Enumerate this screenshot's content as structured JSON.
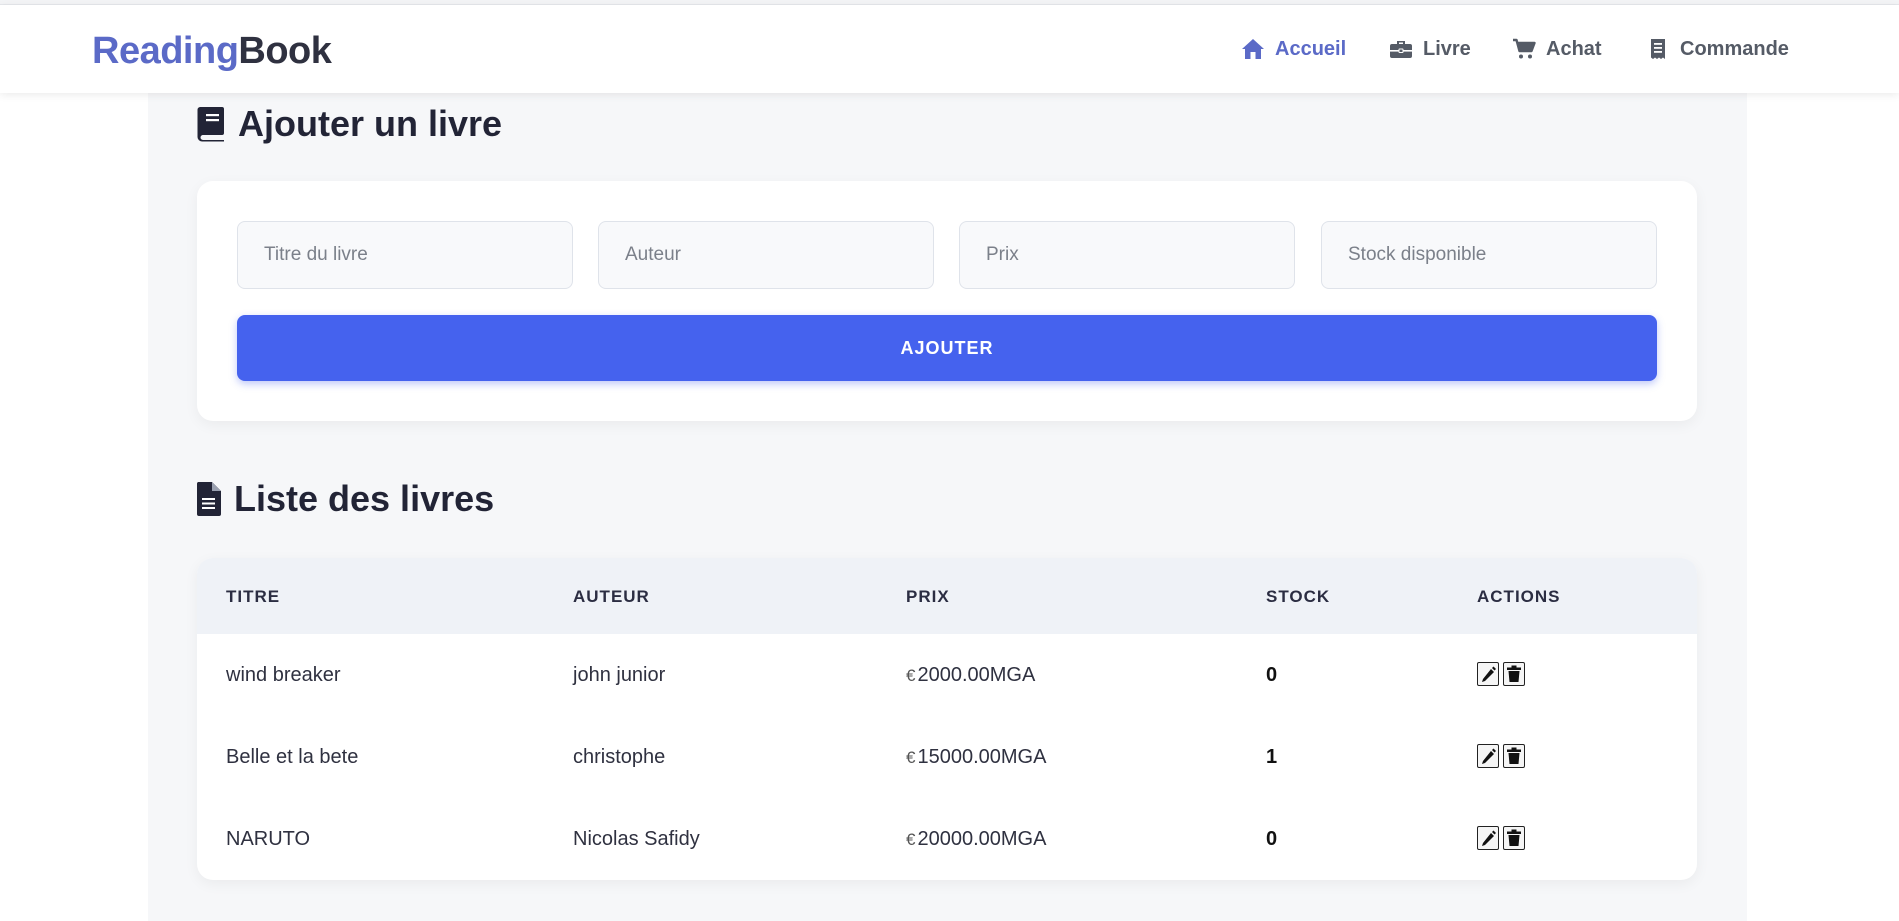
{
  "brand": {
    "part1": "Reading",
    "part2": "Book"
  },
  "nav": [
    {
      "label": "Accueil",
      "icon": "home-icon",
      "active": true
    },
    {
      "label": "Livre",
      "icon": "briefcase-icon",
      "active": false
    },
    {
      "label": "Achat",
      "icon": "cart-icon",
      "active": false
    },
    {
      "label": "Commande",
      "icon": "receipt-icon",
      "active": false
    }
  ],
  "add_section": {
    "title": "Ajouter un livre",
    "icon": "book-icon",
    "fields": [
      {
        "placeholder": "Titre du livre",
        "value": ""
      },
      {
        "placeholder": "Auteur",
        "value": ""
      },
      {
        "placeholder": "Prix",
        "value": ""
      },
      {
        "placeholder": "Stock disponible",
        "value": ""
      }
    ],
    "submit_label": "AJOUTER"
  },
  "list_section": {
    "title": "Liste des livres",
    "icon": "file-icon",
    "columns": [
      "TITRE",
      "AUTEUR",
      "PRIX",
      "STOCK",
      "ACTIONS"
    ],
    "rows": [
      {
        "titre": "wind breaker",
        "auteur": "john junior",
        "currency_symbol": "€",
        "prix": "2000.00MGA",
        "stock": "0"
      },
      {
        "titre": "Belle et la bete",
        "auteur": "christophe",
        "currency_symbol": "€",
        "prix": "15000.00MGA",
        "stock": "1"
      },
      {
        "titre": "NARUTO",
        "auteur": "Nicolas Safidy",
        "currency_symbol": "€",
        "prix": "20000.00MGA",
        "stock": "0"
      }
    ],
    "row_actions": [
      "edit-icon",
      "trash-icon"
    ]
  },
  "colors": {
    "brand_accent": "#5b6ac7",
    "button_primary": "#4562ee",
    "page_background": "#f6f7f9",
    "table_header_background": "#eff2f7"
  }
}
